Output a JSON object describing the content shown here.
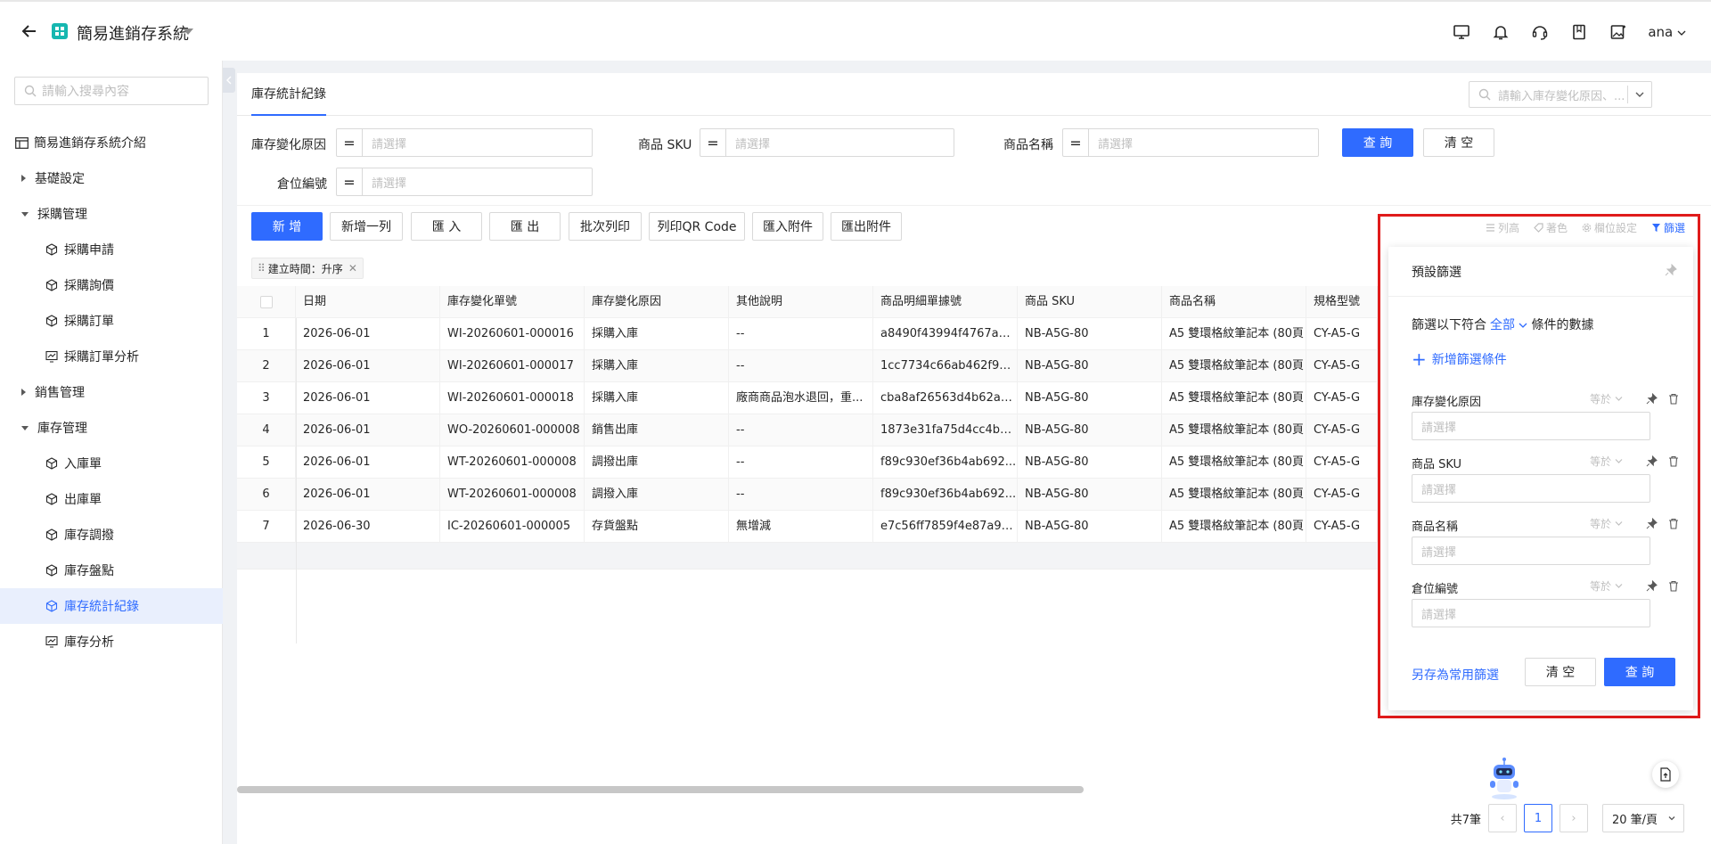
{
  "app": {
    "title": "簡易進銷存系統",
    "user": "ana"
  },
  "sidebar": {
    "search_placeholder": "請輸入搜尋內容",
    "items": [
      {
        "label": "簡易進銷存系統介紹",
        "level": 0,
        "icon": "table-icon"
      },
      {
        "label": "基礎設定",
        "level": 1,
        "icon": "caret-right-icon"
      },
      {
        "label": "採購管理",
        "level": 1,
        "icon": "caret-down-icon"
      },
      {
        "label": "採購申請",
        "level": 2,
        "icon": "cube-icon"
      },
      {
        "label": "採購詢價",
        "level": 2,
        "icon": "cube-icon"
      },
      {
        "label": "採購訂單",
        "level": 2,
        "icon": "cube-icon"
      },
      {
        "label": "採購訂單分析",
        "level": 2,
        "icon": "chart-icon"
      },
      {
        "label": "銷售管理",
        "level": 1,
        "icon": "caret-right-icon"
      },
      {
        "label": "庫存管理",
        "level": 1,
        "icon": "caret-down-icon"
      },
      {
        "label": "入庫單",
        "level": 2,
        "icon": "cube-icon"
      },
      {
        "label": "出庫單",
        "level": 2,
        "icon": "cube-icon"
      },
      {
        "label": "庫存調撥",
        "level": 2,
        "icon": "cube-icon"
      },
      {
        "label": "庫存盤點",
        "level": 2,
        "icon": "cube-icon"
      },
      {
        "label": "庫存統計紀錄",
        "level": 2,
        "icon": "cube-icon",
        "active": true
      },
      {
        "label": "庫存分析",
        "level": 2,
        "icon": "chart-icon"
      }
    ]
  },
  "tab": {
    "label": "庫存統計紀錄"
  },
  "top_search": {
    "placeholder": "請輸入庫存變化原因、..."
  },
  "filters": {
    "reason_label": "庫存變化原因",
    "sku_label": "商品 SKU",
    "name_label": "商品名稱",
    "location_label": "倉位編號",
    "eq": "=",
    "placeholder": "請選擇",
    "query_label": "查 詢",
    "clear_label": "清 空"
  },
  "toolbar": {
    "add": "新 增",
    "add_row": "新增一列",
    "import": "匯 入",
    "export": "匯 出",
    "batch_print": "批次列印",
    "print_qr": "列印QR Code",
    "import_attach": "匯入附件",
    "export_attach": "匯出附件"
  },
  "tool_links": {
    "row_height": "列高",
    "color": "著色",
    "column_settings": "欄位設定",
    "filter": "篩選"
  },
  "sort_tag": "建立時間：升序",
  "table": {
    "headers": [
      "日期",
      "庫存變化單號",
      "庫存變化原因",
      "其他說明",
      "商品明細單據號",
      "商品 SKU",
      "商品名稱",
      "規格型號"
    ],
    "rows": [
      {
        "idx": "1",
        "date": "2026-06-01",
        "no": "WI-20260601-000016",
        "reason": "採購入庫",
        "other": "--",
        "detail": "a8490f43994f4767a2...",
        "sku": "NB-A5G-80",
        "name": "A5 雙環格紋筆記本 (80頁",
        "spec": "CY-A5-G"
      },
      {
        "idx": "2",
        "date": "2026-06-01",
        "no": "WI-20260601-000017",
        "reason": "採購入庫",
        "other": "--",
        "detail": "1cc7734c66ab462f9a...",
        "sku": "NB-A5G-80",
        "name": "A5 雙環格紋筆記本 (80頁",
        "spec": "CY-A5-G"
      },
      {
        "idx": "3",
        "date": "2026-06-01",
        "no": "WI-20260601-000018",
        "reason": "採購入庫",
        "other": "廠商商品泡水退回，重...",
        "detail": "cba8af26563d4b62a8...",
        "sku": "NB-A5G-80",
        "name": "A5 雙環格紋筆記本 (80頁",
        "spec": "CY-A5-G"
      },
      {
        "idx": "4",
        "date": "2026-06-01",
        "no": "WO-20260601-000008",
        "reason": "銷售出庫",
        "other": "--",
        "detail": "1873e31fa75d4cc4b3...",
        "sku": "NB-A5G-80",
        "name": "A5 雙環格紋筆記本 (80頁",
        "spec": "CY-A5-G"
      },
      {
        "idx": "5",
        "date": "2026-06-01",
        "no": "WT-20260601-000008",
        "reason": "調撥出庫",
        "other": "--",
        "detail": "f89c930ef36b4ab692...",
        "sku": "NB-A5G-80",
        "name": "A5 雙環格紋筆記本 (80頁",
        "spec": "CY-A5-G"
      },
      {
        "idx": "6",
        "date": "2026-06-01",
        "no": "WT-20260601-000008",
        "reason": "調撥入庫",
        "other": "--",
        "detail": "f89c930ef36b4ab692...",
        "sku": "NB-A5G-80",
        "name": "A5 雙環格紋筆記本 (80頁",
        "spec": "CY-A5-G"
      },
      {
        "idx": "7",
        "date": "2026-06-30",
        "no": "IC-20260601-000005",
        "reason": "存貨盤點",
        "other": "無增減",
        "detail": "e7c56ff7859f4e87a96...",
        "sku": "NB-A5G-80",
        "name": "A5 雙環格紋筆記本 (80頁",
        "spec": "CY-A5-G"
      }
    ]
  },
  "pager": {
    "total": "共7筆",
    "current": "1",
    "page_size": "20 筆/頁"
  },
  "filter_panel": {
    "title": "預設篩選",
    "match_prefix": "篩選以下符合",
    "match_all": "全部",
    "match_suffix": "條件的數據",
    "add_condition": "新增篩選條件",
    "op": "等於",
    "placeholder": "請選擇",
    "conditions": [
      "庫存變化原因",
      "商品 SKU",
      "商品名稱",
      "倉位編號"
    ],
    "save_label": "另存為常用篩選",
    "clear_label": "清 空",
    "query_label": "查 詢"
  },
  "colors": {
    "primary": "#2f6bff",
    "highlight": "#e01b1b",
    "logo": "#16b7b0"
  }
}
